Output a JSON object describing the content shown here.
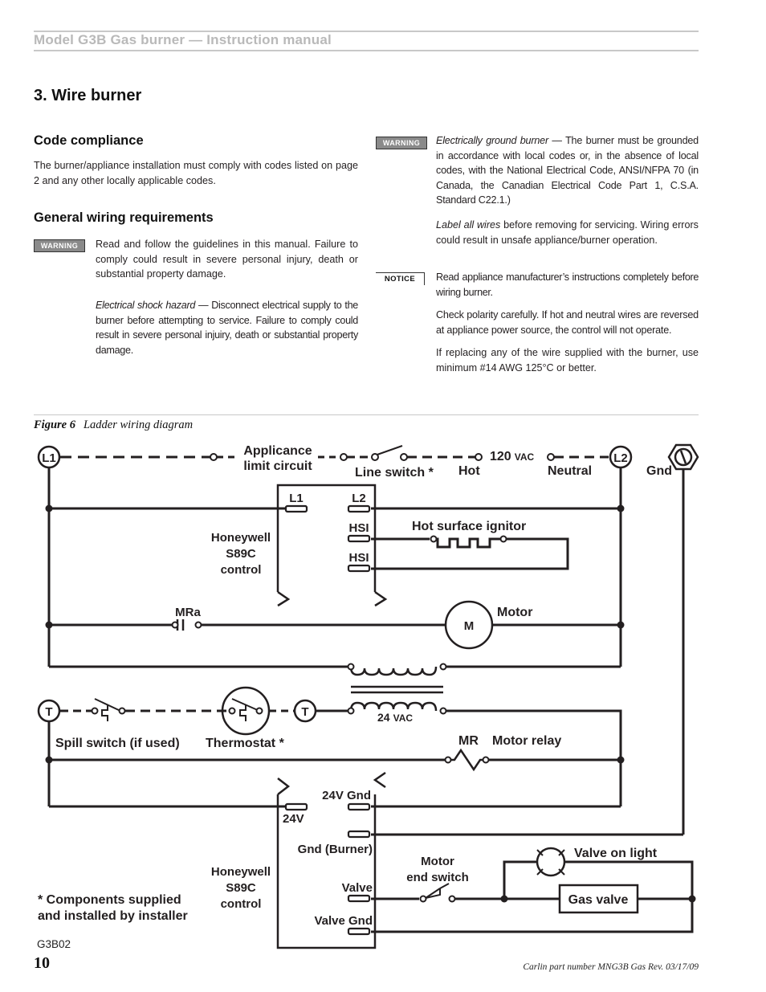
{
  "header": {
    "running_title": "Model G3B Gas burner — Instruction manual"
  },
  "section": {
    "title": "3.  Wire burner"
  },
  "left_column": {
    "code_compliance": {
      "heading": "Code compliance",
      "text": "The burner/appliance installation must comply with codes listed on page 2 and any other locally applicable codes."
    },
    "general_wiring": {
      "heading": "General wiring requirements",
      "badge": "WARNING",
      "paragraph1": "Read and follow the guidelines in this manual.  Failure to comply could result in severe personal injury, death or substantial property damage.",
      "paragraph2_lead": "Electrical shock hazard",
      "paragraph2_rest": " — Disconnect electrical supply to the burner before attempting to service. Failure to comply could result in severe personal injuiry, death or substantial property damage."
    }
  },
  "right_column": {
    "warning": {
      "badge": "WARNING",
      "paragraph1_lead": "Electrically ground burner",
      "paragraph1_rest": " — The burner must be grounded in accordance with local codes or, in the absence of local codes, with the National Electrical Code, ANSI/NFPA 70 (in Canada, the Canadian Electrical Code Part 1, C.S.A. Standard C22.1.)",
      "paragraph2_lead": "Label all wires",
      "paragraph2_rest": " before removing for servicing. Wiring errors could result in unsafe appliance/burner operation."
    },
    "notice": {
      "badge": "NOTICE",
      "paragraph1": "Read appliance manufacturer’s instructions completely before wiring burner.",
      "paragraph2": "Check polarity carefully. If hot and neutral wires are reversed at appliance power source, the control will not operate.",
      "paragraph3": "If replacing any of the wire supplied with the burner, use minimum #14 AWG 125°C or better."
    }
  },
  "figure": {
    "number": "Figure 6",
    "title": "Ladder wiring diagram",
    "id": "G3B02",
    "labels": {
      "L1": "L1",
      "L2": "L2",
      "applicance_limit_1": "Applicance",
      "applicance_limit_2": "limit circuit",
      "line_switch": "Line switch *",
      "hot": "Hot",
      "voltage_120": "120",
      "vac": "VAC",
      "neutral": "Neutral",
      "gnd": "Gnd",
      "ctrl_L1": "L1",
      "ctrl_L2": "L2",
      "hsi_1": "HSI",
      "hsi_2": "HSI",
      "hot_surface_ignitor": "Hot surface ignitor",
      "honeywell_1": "Honeywell",
      "s89c_1": "S89C",
      "control_1": "control",
      "mra": "MRa",
      "motor_symbol": "M",
      "motor": "Motor",
      "T_left": "T",
      "T_right": "T",
      "voltage_24": "24",
      "spill_switch": "Spill switch (if used)",
      "thermostat": "Thermostat *",
      "mr": "MR",
      "motor_relay": "Motor relay",
      "v24_gnd": "24V Gnd",
      "v24": "24V",
      "gnd_burner": "Gnd (Burner)",
      "valve": "Valve",
      "valve_gnd": "Valve Gnd",
      "honeywell_2": "Honeywell",
      "s89c_2": "S89C",
      "control_2": "control",
      "motor_end_switch_1": "Motor",
      "motor_end_switch_2": "end switch",
      "valve_on_light": "Valve on light",
      "gas_valve": "Gas valve",
      "footnote_1": "* Components supplied",
      "footnote_2": "and installed by installer"
    }
  },
  "footer": {
    "page_number": "10",
    "part_number": "Carlin part number MNG3B Gas Rev. 03/17/09"
  }
}
